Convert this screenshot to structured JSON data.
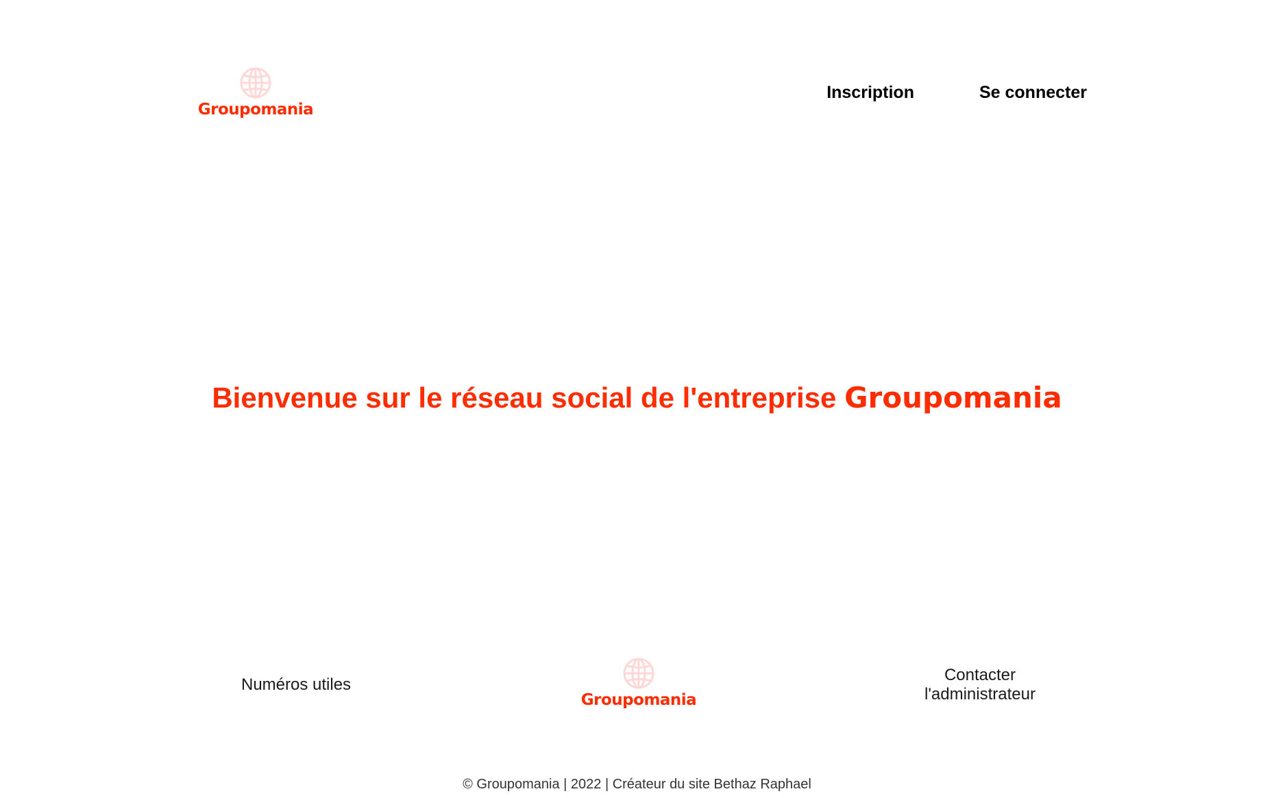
{
  "header": {
    "logo_text": "Groupomania",
    "nav": {
      "signup_label": "Inscription",
      "login_label": "Se connecter"
    }
  },
  "main": {
    "welcome_text": "Bienvenue sur le réseau social de l'entreprise ",
    "welcome_brand": "Groupomania"
  },
  "footer": {
    "useful_numbers_label": "Numéros utiles",
    "logo_text": "Groupomania",
    "contact_line1": "Contacter",
    "contact_line2": "l'administrateur",
    "copyright": "© Groupomania | 2022 | Créateur du site Bethaz Raphael"
  },
  "icons": {
    "logo": "globe-icon"
  },
  "colors": {
    "brand": "#fd2d01",
    "globe": "#ffd7d7",
    "text": "#000000",
    "background": "#ffffff"
  }
}
